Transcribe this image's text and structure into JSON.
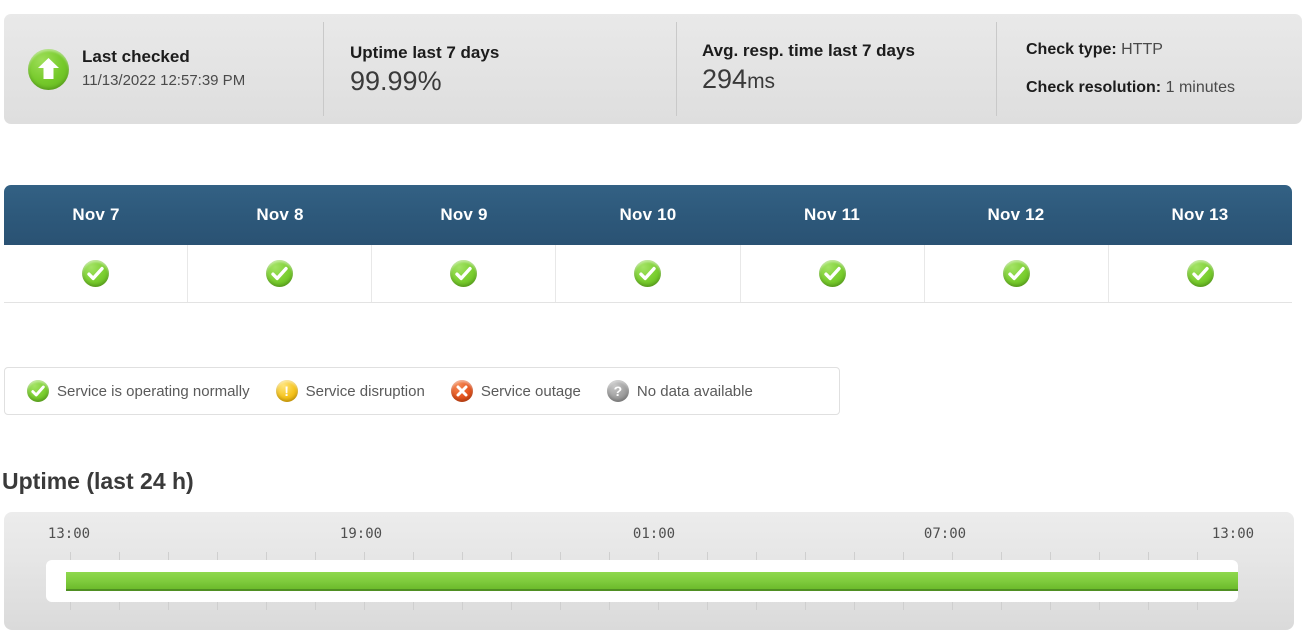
{
  "summary": {
    "last_checked": {
      "icon": "up-arrow-icon",
      "label": "Last checked",
      "value": "11/13/2022 12:57:39 PM"
    },
    "uptime": {
      "label": "Uptime last 7 days",
      "value": "99.99%"
    },
    "response_time": {
      "label": "Avg. resp. time last 7 days",
      "value": "294",
      "unit": "ms"
    },
    "meta": {
      "check_type_label": "Check type:",
      "check_type_value": "HTTP",
      "check_resolution_label": "Check resolution:",
      "check_resolution_value": "1 minutes"
    }
  },
  "days_table": {
    "columns": [
      {
        "date": "Nov 7",
        "status": "ok"
      },
      {
        "date": "Nov 8",
        "status": "ok"
      },
      {
        "date": "Nov 9",
        "status": "ok"
      },
      {
        "date": "Nov 10",
        "status": "ok"
      },
      {
        "date": "Nov 11",
        "status": "ok"
      },
      {
        "date": "Nov 12",
        "status": "ok"
      },
      {
        "date": "Nov 13",
        "status": "ok"
      }
    ]
  },
  "legend": {
    "items": [
      {
        "icon": "check-circle-icon",
        "label": "Service is operating normally",
        "color": "#79cd2e"
      },
      {
        "icon": "exclamation-circle-icon",
        "label": "Service disruption",
        "color": "#f5c31c"
      },
      {
        "icon": "x-circle-icon",
        "label": "Service outage",
        "color": "#e4541e"
      },
      {
        "icon": "question-circle-icon",
        "label": "No data available",
        "color": "#9f9f9f"
      }
    ]
  },
  "uptime_section": {
    "title": "Uptime (last 24 h)",
    "axis_labels": [
      "13:00",
      "19:00",
      "01:00",
      "07:00",
      "13:00"
    ],
    "bar_color": "#7ecb3c",
    "status": "ok"
  },
  "chart_data": {
    "type": "bar",
    "title": "Uptime (last 24 h)",
    "xlabel": "",
    "ylabel": "",
    "x_tick_labels": [
      "13:00",
      "19:00",
      "01:00",
      "07:00",
      "13:00"
    ],
    "x_tick_positions_pct": [
      2,
      26,
      51,
      76,
      100
    ],
    "hour_ticks": 24,
    "grid": true,
    "legend_position": "above",
    "series": [
      {
        "name": "Uptime",
        "segments": [
          {
            "start": "13:00",
            "end": "13:00",
            "status": "up",
            "coverage_pct": 100,
            "color": "#7ecb3c"
          }
        ]
      }
    ],
    "summary_metrics": {
      "uptime_last_7_days_pct": 99.99,
      "avg_response_time_ms": 294,
      "check_resolution_minutes": 1
    },
    "daily_status": {
      "categories": [
        "Nov 7",
        "Nov 8",
        "Nov 9",
        "Nov 10",
        "Nov 11",
        "Nov 12",
        "Nov 13"
      ],
      "values": [
        "ok",
        "ok",
        "ok",
        "ok",
        "ok",
        "ok",
        "ok"
      ]
    }
  }
}
